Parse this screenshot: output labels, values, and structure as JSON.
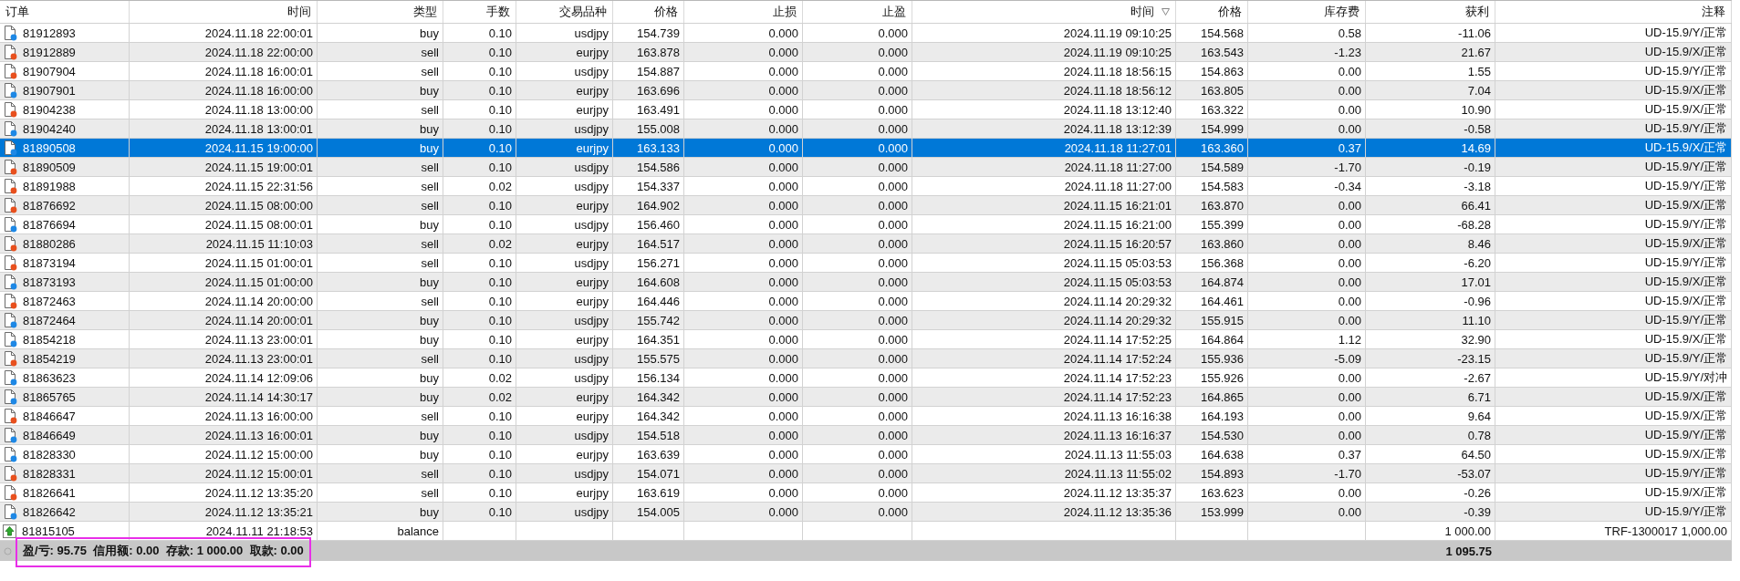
{
  "table": {
    "columns": [
      {
        "label": "订单",
        "sorted": false
      },
      {
        "label": "时间",
        "sorted": false
      },
      {
        "label": "类型",
        "sorted": false
      },
      {
        "label": "手数",
        "sorted": false
      },
      {
        "label": "交易品种",
        "sorted": false
      },
      {
        "label": "价格",
        "sorted": false
      },
      {
        "label": "止损",
        "sorted": false
      },
      {
        "label": "止盈",
        "sorted": false
      },
      {
        "label": "时间",
        "sorted": true
      },
      {
        "label": "价格",
        "sorted": false
      },
      {
        "label": "库存费",
        "sorted": false
      },
      {
        "label": "获利",
        "sorted": false
      },
      {
        "label": "注释",
        "sorted": false
      }
    ],
    "rows": [
      {
        "kind": "buy",
        "selected": false,
        "cells": [
          "81912893",
          "2024.11.18 22:00:01",
          "buy",
          "0.10",
          "usdjpy",
          "154.739",
          "0.000",
          "0.000",
          "2024.11.19 09:10:25",
          "154.568",
          "0.58",
          "-11.06",
          "UD-15.9/Y/正常"
        ]
      },
      {
        "kind": "sell",
        "selected": false,
        "cells": [
          "81912889",
          "2024.11.18 22:00:00",
          "sell",
          "0.10",
          "eurjpy",
          "163.878",
          "0.000",
          "0.000",
          "2024.11.19 09:10:25",
          "163.543",
          "-1.23",
          "21.67",
          "UD-15.9/X/正常"
        ]
      },
      {
        "kind": "sell",
        "selected": false,
        "cells": [
          "81907904",
          "2024.11.18 16:00:01",
          "sell",
          "0.10",
          "usdjpy",
          "154.887",
          "0.000",
          "0.000",
          "2024.11.18 18:56:15",
          "154.863",
          "0.00",
          "1.55",
          "UD-15.9/Y/正常"
        ]
      },
      {
        "kind": "buy",
        "selected": false,
        "cells": [
          "81907901",
          "2024.11.18 16:00:00",
          "buy",
          "0.10",
          "eurjpy",
          "163.696",
          "0.000",
          "0.000",
          "2024.11.18 18:56:12",
          "163.805",
          "0.00",
          "7.04",
          "UD-15.9/X/正常"
        ]
      },
      {
        "kind": "sell",
        "selected": false,
        "cells": [
          "81904238",
          "2024.11.18 13:00:00",
          "sell",
          "0.10",
          "eurjpy",
          "163.491",
          "0.000",
          "0.000",
          "2024.11.18 13:12:40",
          "163.322",
          "0.00",
          "10.90",
          "UD-15.9/X/正常"
        ]
      },
      {
        "kind": "buy",
        "selected": false,
        "cells": [
          "81904240",
          "2024.11.18 13:00:01",
          "buy",
          "0.10",
          "usdjpy",
          "155.008",
          "0.000",
          "0.000",
          "2024.11.18 13:12:39",
          "154.999",
          "0.00",
          "-0.58",
          "UD-15.9/Y/正常"
        ]
      },
      {
        "kind": "buy",
        "selected": true,
        "cells": [
          "81890508",
          "2024.11.15 19:00:00",
          "buy",
          "0.10",
          "eurjpy",
          "163.133",
          "0.000",
          "0.000",
          "2024.11.18 11:27:01",
          "163.360",
          "0.37",
          "14.69",
          "UD-15.9/X/正常"
        ]
      },
      {
        "kind": "sell",
        "selected": false,
        "cells": [
          "81890509",
          "2024.11.15 19:00:01",
          "sell",
          "0.10",
          "usdjpy",
          "154.586",
          "0.000",
          "0.000",
          "2024.11.18 11:27:00",
          "154.589",
          "-1.70",
          "-0.19",
          "UD-15.9/Y/正常"
        ]
      },
      {
        "kind": "sell",
        "selected": false,
        "cells": [
          "81891988",
          "2024.11.15 22:31:56",
          "sell",
          "0.02",
          "usdjpy",
          "154.337",
          "0.000",
          "0.000",
          "2024.11.18 11:27:00",
          "154.583",
          "-0.34",
          "-3.18",
          "UD-15.9/Y/正常"
        ]
      },
      {
        "kind": "sell",
        "selected": false,
        "cells": [
          "81876692",
          "2024.11.15 08:00:00",
          "sell",
          "0.10",
          "eurjpy",
          "164.902",
          "0.000",
          "0.000",
          "2024.11.15 16:21:01",
          "163.870",
          "0.00",
          "66.41",
          "UD-15.9/X/正常"
        ]
      },
      {
        "kind": "buy",
        "selected": false,
        "cells": [
          "81876694",
          "2024.11.15 08:00:01",
          "buy",
          "0.10",
          "usdjpy",
          "156.460",
          "0.000",
          "0.000",
          "2024.11.15 16:21:00",
          "155.399",
          "0.00",
          "-68.28",
          "UD-15.9/Y/正常"
        ]
      },
      {
        "kind": "sell",
        "selected": false,
        "cells": [
          "81880286",
          "2024.11.15 11:10:03",
          "sell",
          "0.02",
          "eurjpy",
          "164.517",
          "0.000",
          "0.000",
          "2024.11.15 16:20:57",
          "163.860",
          "0.00",
          "8.46",
          "UD-15.9/X/正常"
        ]
      },
      {
        "kind": "sell",
        "selected": false,
        "cells": [
          "81873194",
          "2024.11.15 01:00:01",
          "sell",
          "0.10",
          "usdjpy",
          "156.271",
          "0.000",
          "0.000",
          "2024.11.15 05:03:53",
          "156.368",
          "0.00",
          "-6.20",
          "UD-15.9/Y/正常"
        ]
      },
      {
        "kind": "buy",
        "selected": false,
        "cells": [
          "81873193",
          "2024.11.15 01:00:00",
          "buy",
          "0.10",
          "eurjpy",
          "164.608",
          "0.000",
          "0.000",
          "2024.11.15 05:03:53",
          "164.874",
          "0.00",
          "17.01",
          "UD-15.9/X/正常"
        ]
      },
      {
        "kind": "sell",
        "selected": false,
        "cells": [
          "81872463",
          "2024.11.14 20:00:00",
          "sell",
          "0.10",
          "eurjpy",
          "164.446",
          "0.000",
          "0.000",
          "2024.11.14 20:29:32",
          "164.461",
          "0.00",
          "-0.96",
          "UD-15.9/X/正常"
        ]
      },
      {
        "kind": "buy",
        "selected": false,
        "cells": [
          "81872464",
          "2024.11.14 20:00:01",
          "buy",
          "0.10",
          "usdjpy",
          "155.742",
          "0.000",
          "0.000",
          "2024.11.14 20:29:32",
          "155.915",
          "0.00",
          "11.10",
          "UD-15.9/Y/正常"
        ]
      },
      {
        "kind": "buy",
        "selected": false,
        "cells": [
          "81854218",
          "2024.11.13 23:00:01",
          "buy",
          "0.10",
          "eurjpy",
          "164.351",
          "0.000",
          "0.000",
          "2024.11.14 17:52:25",
          "164.864",
          "1.12",
          "32.90",
          "UD-15.9/X/正常"
        ]
      },
      {
        "kind": "sell",
        "selected": false,
        "cells": [
          "81854219",
          "2024.11.13 23:00:01",
          "sell",
          "0.10",
          "usdjpy",
          "155.575",
          "0.000",
          "0.000",
          "2024.11.14 17:52:24",
          "155.936",
          "-5.09",
          "-23.15",
          "UD-15.9/Y/正常"
        ]
      },
      {
        "kind": "buy",
        "selected": false,
        "cells": [
          "81863623",
          "2024.11.14 12:09:06",
          "buy",
          "0.02",
          "usdjpy",
          "156.134",
          "0.000",
          "0.000",
          "2024.11.14 17:52:23",
          "155.926",
          "0.00",
          "-2.67",
          "UD-15.9/Y/对冲"
        ]
      },
      {
        "kind": "buy",
        "selected": false,
        "cells": [
          "81865765",
          "2024.11.14 14:30:17",
          "buy",
          "0.02",
          "eurjpy",
          "164.342",
          "0.000",
          "0.000",
          "2024.11.14 17:52:23",
          "164.865",
          "0.00",
          "6.71",
          "UD-15.9/X/正常"
        ]
      },
      {
        "kind": "sell",
        "selected": false,
        "cells": [
          "81846647",
          "2024.11.13 16:00:00",
          "sell",
          "0.10",
          "eurjpy",
          "164.342",
          "0.000",
          "0.000",
          "2024.11.13 16:16:38",
          "164.193",
          "0.00",
          "9.64",
          "UD-15.9/X/正常"
        ]
      },
      {
        "kind": "buy",
        "selected": false,
        "cells": [
          "81846649",
          "2024.11.13 16:00:01",
          "buy",
          "0.10",
          "usdjpy",
          "154.518",
          "0.000",
          "0.000",
          "2024.11.13 16:16:37",
          "154.530",
          "0.00",
          "0.78",
          "UD-15.9/Y/正常"
        ]
      },
      {
        "kind": "buy",
        "selected": false,
        "cells": [
          "81828330",
          "2024.11.12 15:00:00",
          "buy",
          "0.10",
          "eurjpy",
          "163.639",
          "0.000",
          "0.000",
          "2024.11.13 11:55:03",
          "164.638",
          "0.37",
          "64.50",
          "UD-15.9/X/正常"
        ]
      },
      {
        "kind": "sell",
        "selected": false,
        "cells": [
          "81828331",
          "2024.11.12 15:00:01",
          "sell",
          "0.10",
          "usdjpy",
          "154.071",
          "0.000",
          "0.000",
          "2024.11.13 11:55:02",
          "154.893",
          "-1.70",
          "-53.07",
          "UD-15.9/Y/正常"
        ]
      },
      {
        "kind": "sell",
        "selected": false,
        "cells": [
          "81826641",
          "2024.11.12 13:35:20",
          "sell",
          "0.10",
          "eurjpy",
          "163.619",
          "0.000",
          "0.000",
          "2024.11.12 13:35:37",
          "163.623",
          "0.00",
          "-0.26",
          "UD-15.9/X/正常"
        ]
      },
      {
        "kind": "buy",
        "selected": false,
        "cells": [
          "81826642",
          "2024.11.12 13:35:21",
          "buy",
          "0.10",
          "usdjpy",
          "154.005",
          "0.000",
          "0.000",
          "2024.11.12 13:35:36",
          "153.999",
          "0.00",
          "-0.39",
          "UD-15.9/Y/正常"
        ]
      },
      {
        "kind": "balance",
        "selected": false,
        "cells": [
          "81815105",
          "2024.11.11 21:18:53",
          "balance",
          null,
          null,
          null,
          null,
          null,
          null,
          null,
          null,
          "1 000.00",
          "TRF-1300017 1,000.00"
        ]
      }
    ],
    "summary": {
      "text": "盈/亏: 95.75  信用额: 0.00  存款: 1 000.00  取款: 0.00",
      "total": "1 095.75",
      "highlighted": true
    }
  }
}
